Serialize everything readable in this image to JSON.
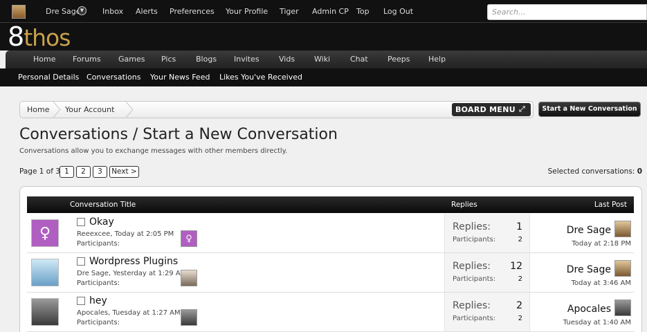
{
  "topbar": {
    "user": "Dre Sage",
    "links": [
      "Inbox",
      "Alerts",
      "Preferences",
      "Your Profile",
      "Tiger",
      "Admin CP",
      "Top",
      "Log Out"
    ],
    "search_placeholder": "Search..."
  },
  "logo": {
    "eight": "8",
    "rest": "thos"
  },
  "mainnav": [
    "Home",
    "Forums",
    "Games",
    "Pics",
    "Blogs",
    "Invites",
    "Vids",
    "Wiki",
    "Chat",
    "Peeps",
    "Help"
  ],
  "subnav": [
    "Personal Details",
    "Conversations",
    "Your News Feed",
    "Likes You've Received"
  ],
  "breadcrumb": {
    "home": "Home",
    "account": "Your Account",
    "board_menu": "BOARD MENU"
  },
  "start_button": "Start a New Conversation",
  "page": {
    "title": "Conversations / Start a New Conversation",
    "description": "Conversations allow you to exchange messages with other members directly."
  },
  "pagination": {
    "label": "Page 1 of 3",
    "pages": [
      "1",
      "2",
      "3"
    ],
    "next": "Next >"
  },
  "selected": {
    "label": "Selected conversations:",
    "count": "0"
  },
  "list_header": {
    "title": "Conversation Title",
    "replies": "Replies",
    "last_post": "Last Post"
  },
  "conversations": [
    {
      "title": "Okay",
      "meta": "Reeexcee, Today at 2:05 PM",
      "participants_label": "Participants:",
      "replies_label": "Replies:",
      "replies": "1",
      "participants_stat_label": "Participants:",
      "participants": "2",
      "last_user": "Dre Sage",
      "last_time": "Today at 2:18 PM"
    },
    {
      "title": "Wordpress Plugins",
      "meta": "Dre Sage, Yesterday at 1:29 A",
      "participants_label": "Participants:",
      "replies_label": "Replies:",
      "replies": "12",
      "participants_stat_label": "Participants:",
      "participants": "2",
      "last_user": "Dre Sage",
      "last_time": "Today at 3:46 AM"
    },
    {
      "title": "hey",
      "meta": "Apocales, Tuesday at 1:27 AM",
      "participants_label": "Participants:",
      "replies_label": "Replies:",
      "replies": "2",
      "participants_stat_label": "Participants:",
      "participants": "2",
      "last_user": "Apocales",
      "last_time": "Tuesday at 1:40 AM"
    }
  ]
}
